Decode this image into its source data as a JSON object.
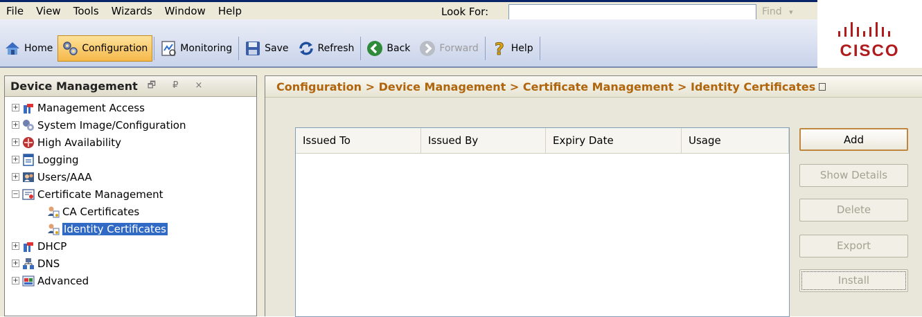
{
  "menu": {
    "items": [
      "File",
      "View",
      "Tools",
      "Wizards",
      "Window",
      "Help"
    ],
    "lookfor_label": "Look For:",
    "lookfor_value": "",
    "find_label": "Find",
    "find_arrow": "▾"
  },
  "toolbar": {
    "home": "Home",
    "configuration": "Configuration",
    "monitoring": "Monitoring",
    "save": "Save",
    "refresh": "Refresh",
    "back": "Back",
    "forward": "Forward",
    "help": "Help"
  },
  "logo": {
    "text": "CISCO"
  },
  "left_panel": {
    "title": "Device Management",
    "header_icons": "🗗 ₽ ×",
    "tree": [
      {
        "label": "Management Access",
        "icon": "management-access-icon"
      },
      {
        "label": "System Image/Configuration",
        "icon": "system-image-icon"
      },
      {
        "label": "High Availability",
        "icon": "high-availability-icon"
      },
      {
        "label": "Logging",
        "icon": "logging-icon"
      },
      {
        "label": "Users/AAA",
        "icon": "users-aaa-icon"
      },
      {
        "label": "Certificate Management",
        "icon": "certificate-management-icon"
      },
      {
        "label": "CA Certificates",
        "icon": "ca-certificates-icon"
      },
      {
        "label": "Identity Certificates",
        "icon": "identity-certificates-icon"
      },
      {
        "label": "DHCP",
        "icon": "dhcp-icon"
      },
      {
        "label": "DNS",
        "icon": "dns-icon"
      },
      {
        "label": "Advanced",
        "icon": "advanced-icon"
      }
    ]
  },
  "right_panel": {
    "breadcrumb": "Configuration > Device Management > Certificate Management > Identity Certificates",
    "table_headers": [
      "Issued To",
      "Issued By",
      "Expiry Date",
      "Usage"
    ],
    "buttons": {
      "add": "Add",
      "show_details": "Show Details",
      "delete": "Delete",
      "export": "Export",
      "install": "Install"
    }
  },
  "colors": {
    "accent_orange": "#b0650c",
    "selection_blue": "#316ac5",
    "cisco_red": "#b11b1b"
  }
}
